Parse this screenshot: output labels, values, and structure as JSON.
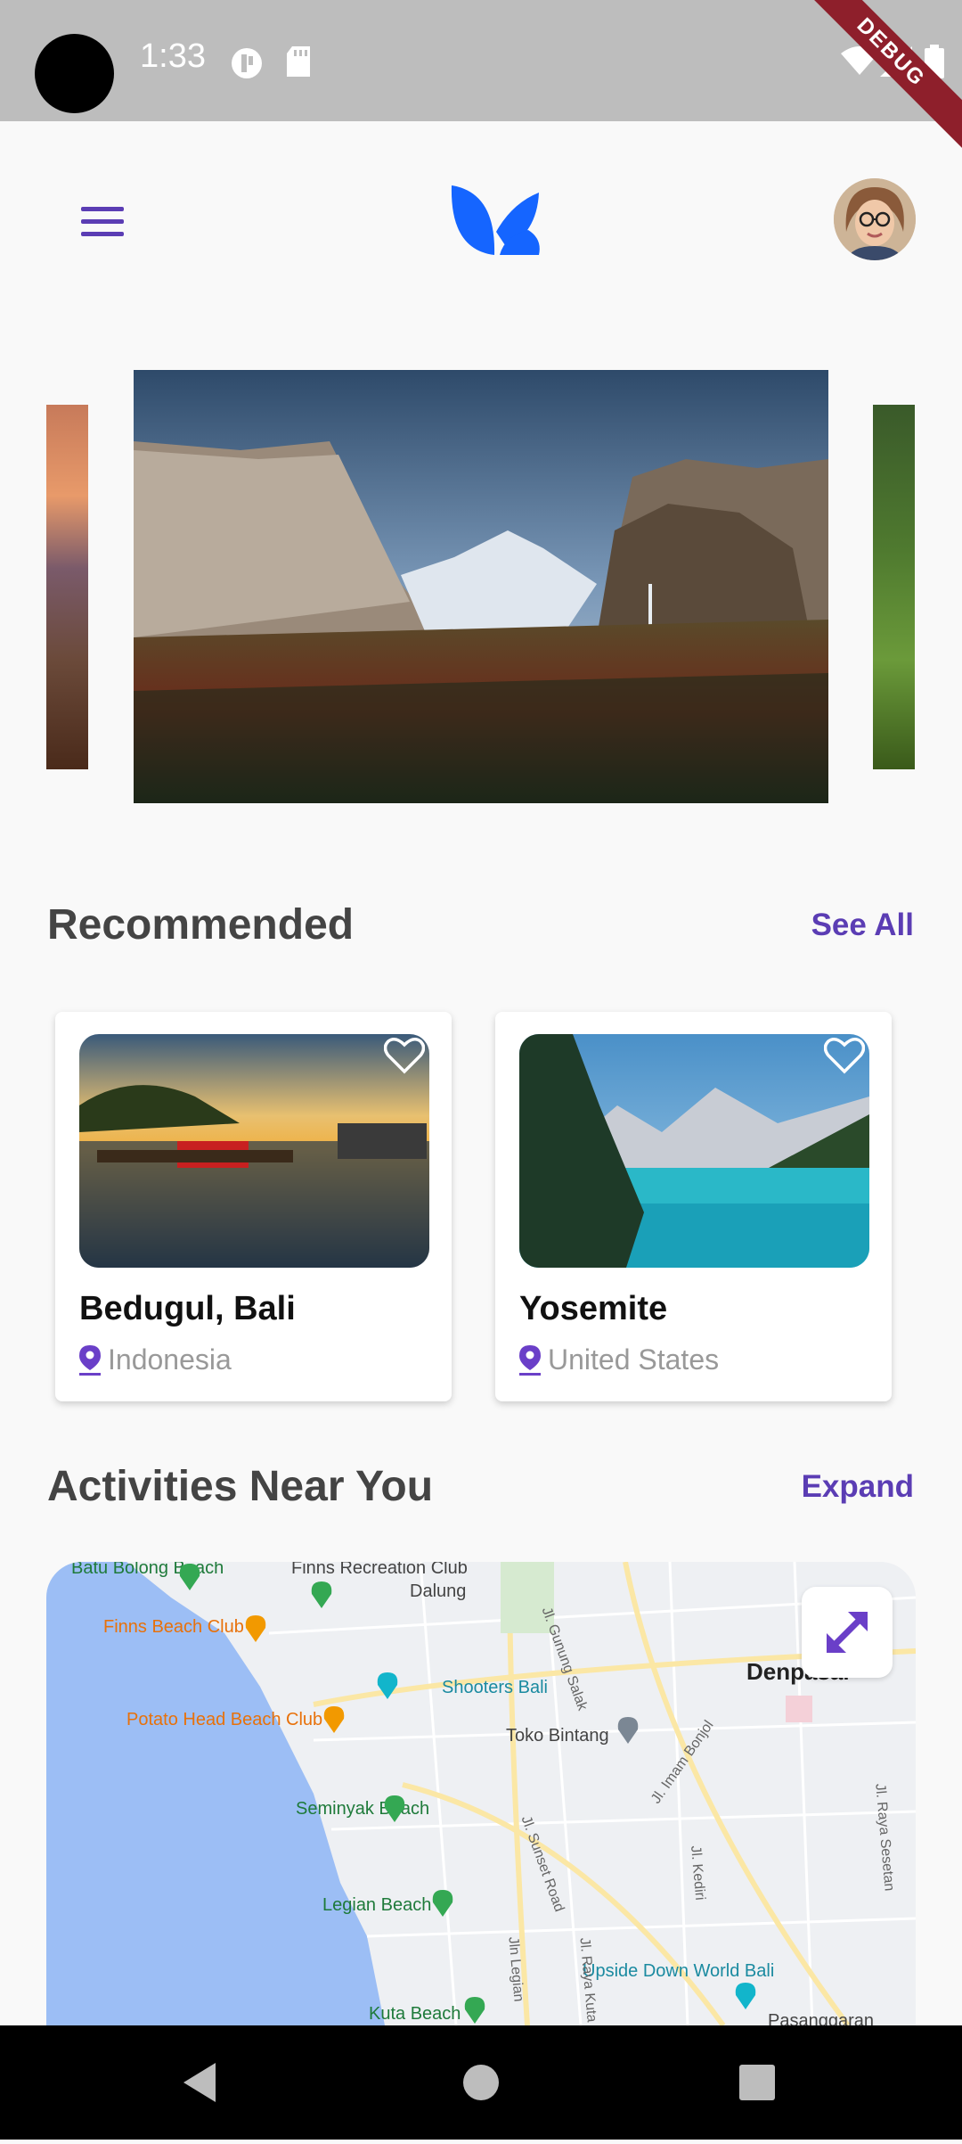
{
  "status_bar": {
    "time": "1:33",
    "icons": [
      "circle-badge-icon",
      "sd-card-icon",
      "wifi-icon",
      "signal-icon",
      "battery-icon"
    ]
  },
  "debug_banner": "DEBUG",
  "header": {
    "menu_icon": "hamburger-menu-icon",
    "logo": "app-logo-icon",
    "avatar": "user-avatar"
  },
  "recommended": {
    "title": "Recommended",
    "link": "See All",
    "cards": [
      {
        "title": "Bedugul, Bali",
        "location": "Indonesia",
        "favorited": false
      },
      {
        "title": "Yosemite",
        "location": "United States",
        "favorited": false
      }
    ]
  },
  "activities": {
    "title": "Activities Near You",
    "link": "Expand"
  },
  "map": {
    "labels": {
      "batu_bolong": "Batu Bolong Beach",
      "finns_recreation": "Finns Recreation Club",
      "dalung": "Dalung",
      "finns_beach": "Finns Beach Club",
      "shooters": "Shooters Bali",
      "potato_head": "Potato Head Beach Club",
      "toko_bintang": "Toko Bintang",
      "seminyak": "Seminyak Beach",
      "legian": "Legian Beach",
      "kuta": "Kuta Beach",
      "upside_down": "Upside Down World Bali",
      "pasanggaran": "Pasanggaran",
      "denpasar": "Denpasar",
      "jl_gunung_salak": "Jl. Gunung Salak",
      "jl_imam_bonjol": "Jl. Imam Bonjol",
      "jl_sunset_road": "Jl. Sunset Road",
      "jl_kediri": "Jl. Kediri",
      "jl_raya_sesetan": "Jl. Raya Sesetan",
      "jln_legian": "Jln Legian",
      "jl_raya_kuta": "Jl. Raya Kuta"
    },
    "colors": {
      "sea": "#9cbef5",
      "land": "#eef0f3",
      "road": "#ffffff",
      "main_road": "#fbe7a5"
    }
  },
  "accent_color": "#5b3db4",
  "nav_bar": {
    "buttons": [
      "back-icon",
      "home-icon",
      "recents-icon"
    ]
  }
}
